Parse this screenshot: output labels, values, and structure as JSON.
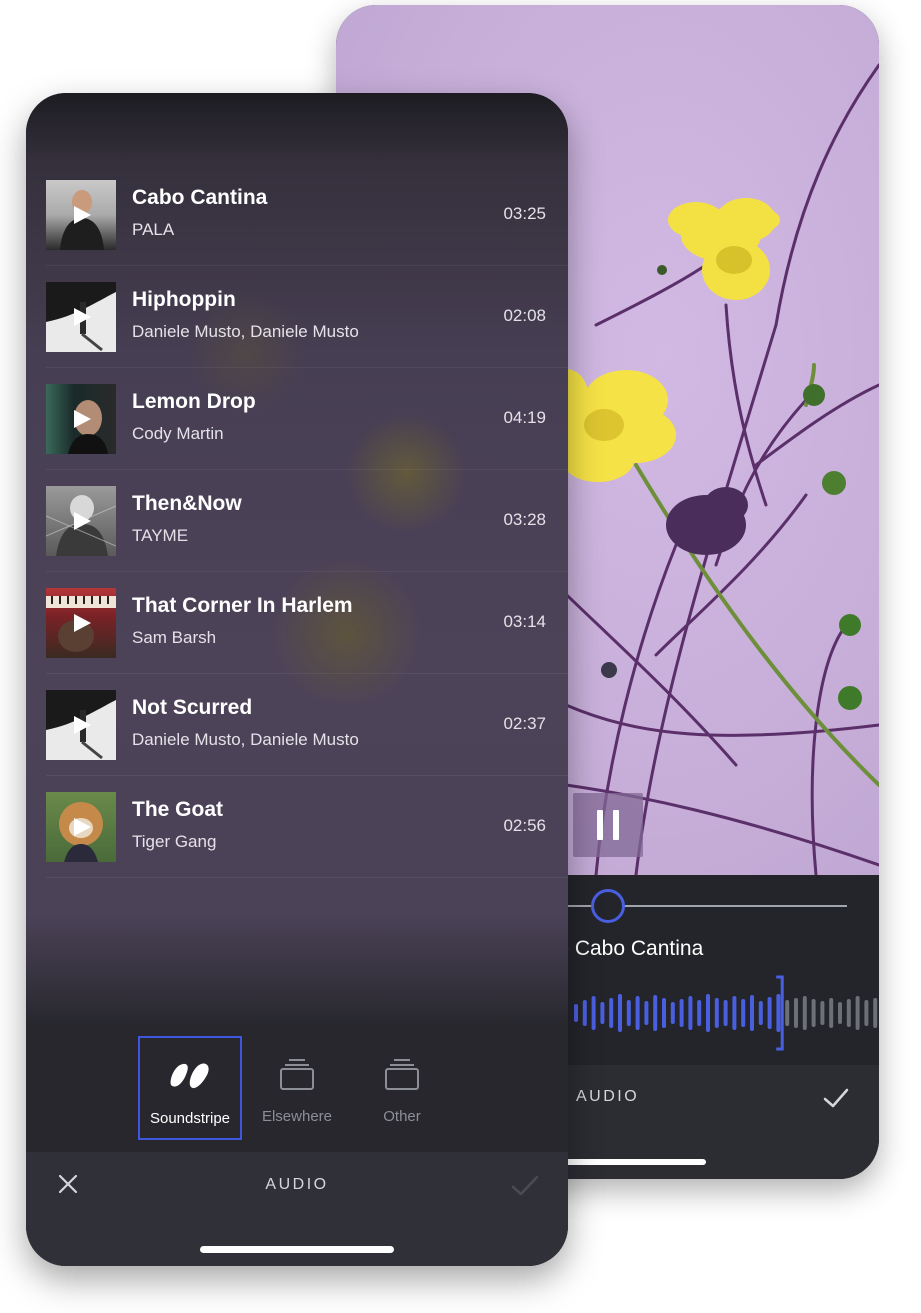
{
  "back_screen": {
    "now_playing_title": "- Cabo Cantina",
    "footer_label": "AUDIO",
    "accent_color": "#4a5fe0",
    "playback_progress": 0.45
  },
  "front_screen": {
    "tracks": [
      {
        "title": "Cabo Cantina",
        "artist": "PALA",
        "duration": "03:25"
      },
      {
        "title": "Hiphoppin",
        "artist": "Daniele Musto, Daniele Musto",
        "duration": "02:08"
      },
      {
        "title": "Lemon Drop",
        "artist": "Cody Martin",
        "duration": "04:19"
      },
      {
        "title": "Then&Now",
        "artist": "TAYME",
        "duration": "03:28"
      },
      {
        "title": "That Corner In Harlem",
        "artist": "Sam Barsh",
        "duration": "03:14"
      },
      {
        "title": "Not Scurred",
        "artist": "Daniele Musto, Daniele Musto",
        "duration": "02:37"
      },
      {
        "title": "The Goat",
        "artist": "Tiger Gang",
        "duration": "02:56"
      }
    ],
    "sources": [
      {
        "label": "Soundstripe",
        "icon": "soundstripe-logo-icon",
        "active": true
      },
      {
        "label": "Elsewhere",
        "icon": "stack-icon",
        "active": false
      },
      {
        "label": "Other",
        "icon": "stack-icon",
        "active": false
      }
    ],
    "footer_label": "AUDIO",
    "accent_color": "#3e57e0"
  }
}
